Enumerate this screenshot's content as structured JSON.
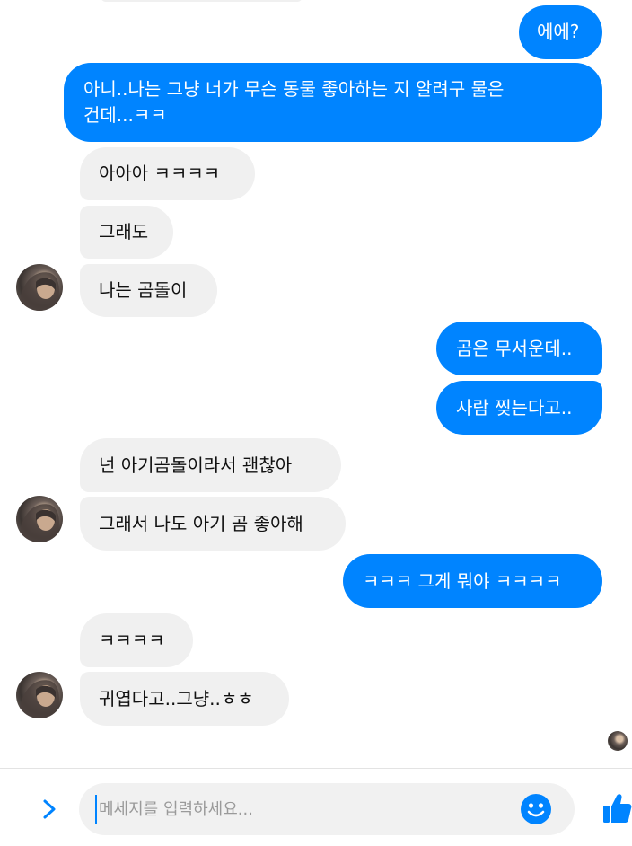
{
  "colors": {
    "outgoing_bubble": "#0084ff",
    "incoming_bubble": "#f0f0f0",
    "accent": "#0084ff"
  },
  "messages": [
    {
      "direction": "out",
      "text": "에에?"
    },
    {
      "direction": "out",
      "text": "아니..나는 그냥 너가 무슨 동물 좋아하는 지 알려구 물은\n건데...ㅋㅋ"
    },
    {
      "direction": "in",
      "text": "아아아 ㅋㅋㅋㅋ"
    },
    {
      "direction": "in",
      "text": "그래도"
    },
    {
      "direction": "in",
      "text": "나는 곰돌이"
    },
    {
      "direction": "out",
      "text": "곰은 무서운데.."
    },
    {
      "direction": "out",
      "text": "사람 찢는다고.."
    },
    {
      "direction": "in",
      "text": "넌 아기곰돌이라서 괜찮아"
    },
    {
      "direction": "in",
      "text": "그래서 나도 아기 곰 좋아해"
    },
    {
      "direction": "out",
      "text": "ㅋㅋㅋ 그게 뭐야 ㅋㅋㅋㅋ"
    },
    {
      "direction": "in",
      "text": "ㅋㅋㅋㅋ"
    },
    {
      "direction": "in",
      "text": "귀엽다고..그냥..ㅎㅎ"
    }
  ],
  "composer": {
    "placeholder": "메세지를 입력하세요...",
    "expand_icon": "chevron-right-icon",
    "emoji_icon": "smiley-icon",
    "send_icon": "thumbs-up-icon"
  }
}
